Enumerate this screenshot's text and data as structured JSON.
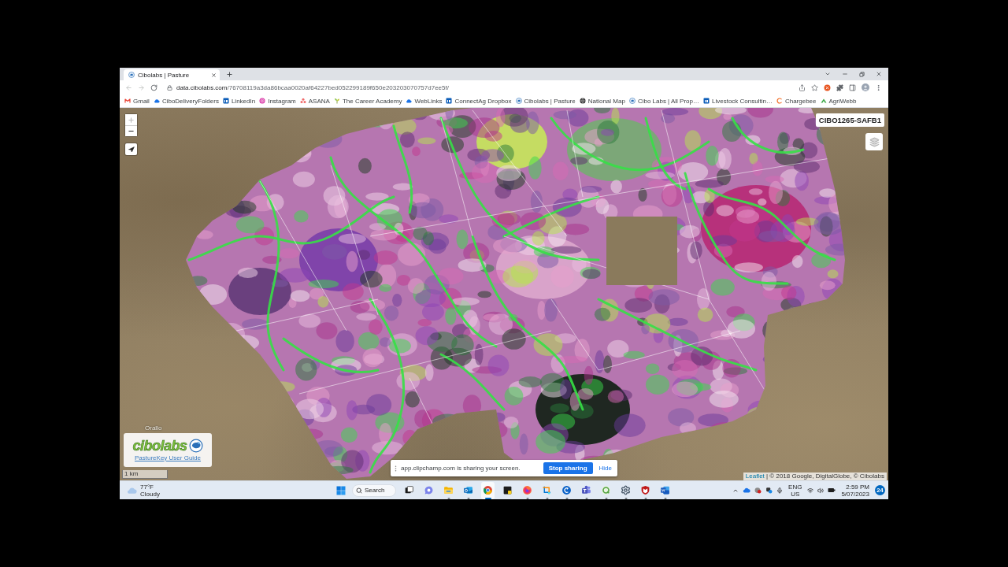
{
  "browser": {
    "tabs": [
      {
        "title": "Cibolabs | Pasture",
        "selected": true
      }
    ],
    "navigation": [
      {
        "kind": "back",
        "disabled": true
      },
      {
        "kind": "forward",
        "disabled": true
      },
      {
        "kind": "reload",
        "disabled": false
      }
    ],
    "address": {
      "host": "data.cibolabs.com",
      "path": "/76708119a3da86bcaa0020af64227bed052299189f650e203203070757d7ee5f/"
    },
    "bookmarks": [
      {
        "label": "Gmail",
        "kind": "mail"
      },
      {
        "label": "CiboDeliveryFolders",
        "kind": "cloud"
      },
      {
        "label": "LinkedIn",
        "kind": "tile"
      },
      {
        "label": "Instagram",
        "kind": "camera"
      },
      {
        "label": "ASANA",
        "kind": "dots"
      },
      {
        "label": "The Career Academy",
        "kind": "sprout"
      },
      {
        "label": "WebLinks",
        "kind": "cloud"
      },
      {
        "label": "ConnectAg Dropbox",
        "kind": "tile"
      },
      {
        "label": "Cibolabs | Pasture",
        "kind": "emblem"
      },
      {
        "label": "National Map",
        "kind": "globe"
      },
      {
        "label": "Cibo Labs | All Prop…",
        "kind": "emblem"
      },
      {
        "label": "Livestock Consultin…",
        "kind": "tile"
      },
      {
        "label": "Chargebee",
        "kind": "arc"
      },
      {
        "label": "AgriWebb",
        "kind": "chevron"
      }
    ]
  },
  "map": {
    "zoom": [
      {
        "kind": "in",
        "disabled": true
      },
      {
        "kind": "out",
        "disabled": false
      }
    ],
    "property_label": "CIBO1265-SAFB1",
    "place_labels": [
      "Orallo"
    ],
    "logo": {
      "wordmark": "cibolabs",
      "link": "PastureKey User Guide"
    },
    "scale": "1 km",
    "attribution": {
      "link": "Leaflet",
      "text": "| © 2018 Google, DigitalGlobe, © Cibolabs"
    }
  },
  "share_notice": {
    "message": "app.clipchamp.com is sharing your screen.",
    "stop_button": "Stop sharing",
    "hide_button": "Hide"
  },
  "taskbar": {
    "weather": {
      "temperature": "77°F",
      "condition": "Cloudy"
    },
    "search": {
      "placeholder": "Search"
    },
    "apps": [
      {
        "kind": "task-view",
        "running": false,
        "focused": false
      },
      {
        "kind": "chat",
        "running": false,
        "focused": false
      },
      {
        "kind": "folder",
        "running": true,
        "focused": false
      },
      {
        "kind": "mail",
        "running": true,
        "focused": false
      },
      {
        "kind": "browser",
        "running": true,
        "focused": true
      },
      {
        "kind": "notes",
        "running": false,
        "focused": false
      },
      {
        "kind": "fox",
        "running": true,
        "focused": false
      },
      {
        "kind": "snip",
        "running": true,
        "focused": false
      },
      {
        "kind": "recorder",
        "running": true,
        "focused": false
      },
      {
        "kind": "team",
        "running": true,
        "focused": false
      },
      {
        "kind": "ring",
        "running": true,
        "focused": false
      },
      {
        "kind": "gear",
        "running": true,
        "focused": false
      },
      {
        "kind": "shield",
        "running": true,
        "focused": false
      },
      {
        "kind": "document",
        "running": true,
        "focused": false
      }
    ],
    "tray": {
      "language": "ENG",
      "region": "US",
      "time": "2:59 PM",
      "date": "5/07/2023",
      "notifications": "24"
    }
  }
}
